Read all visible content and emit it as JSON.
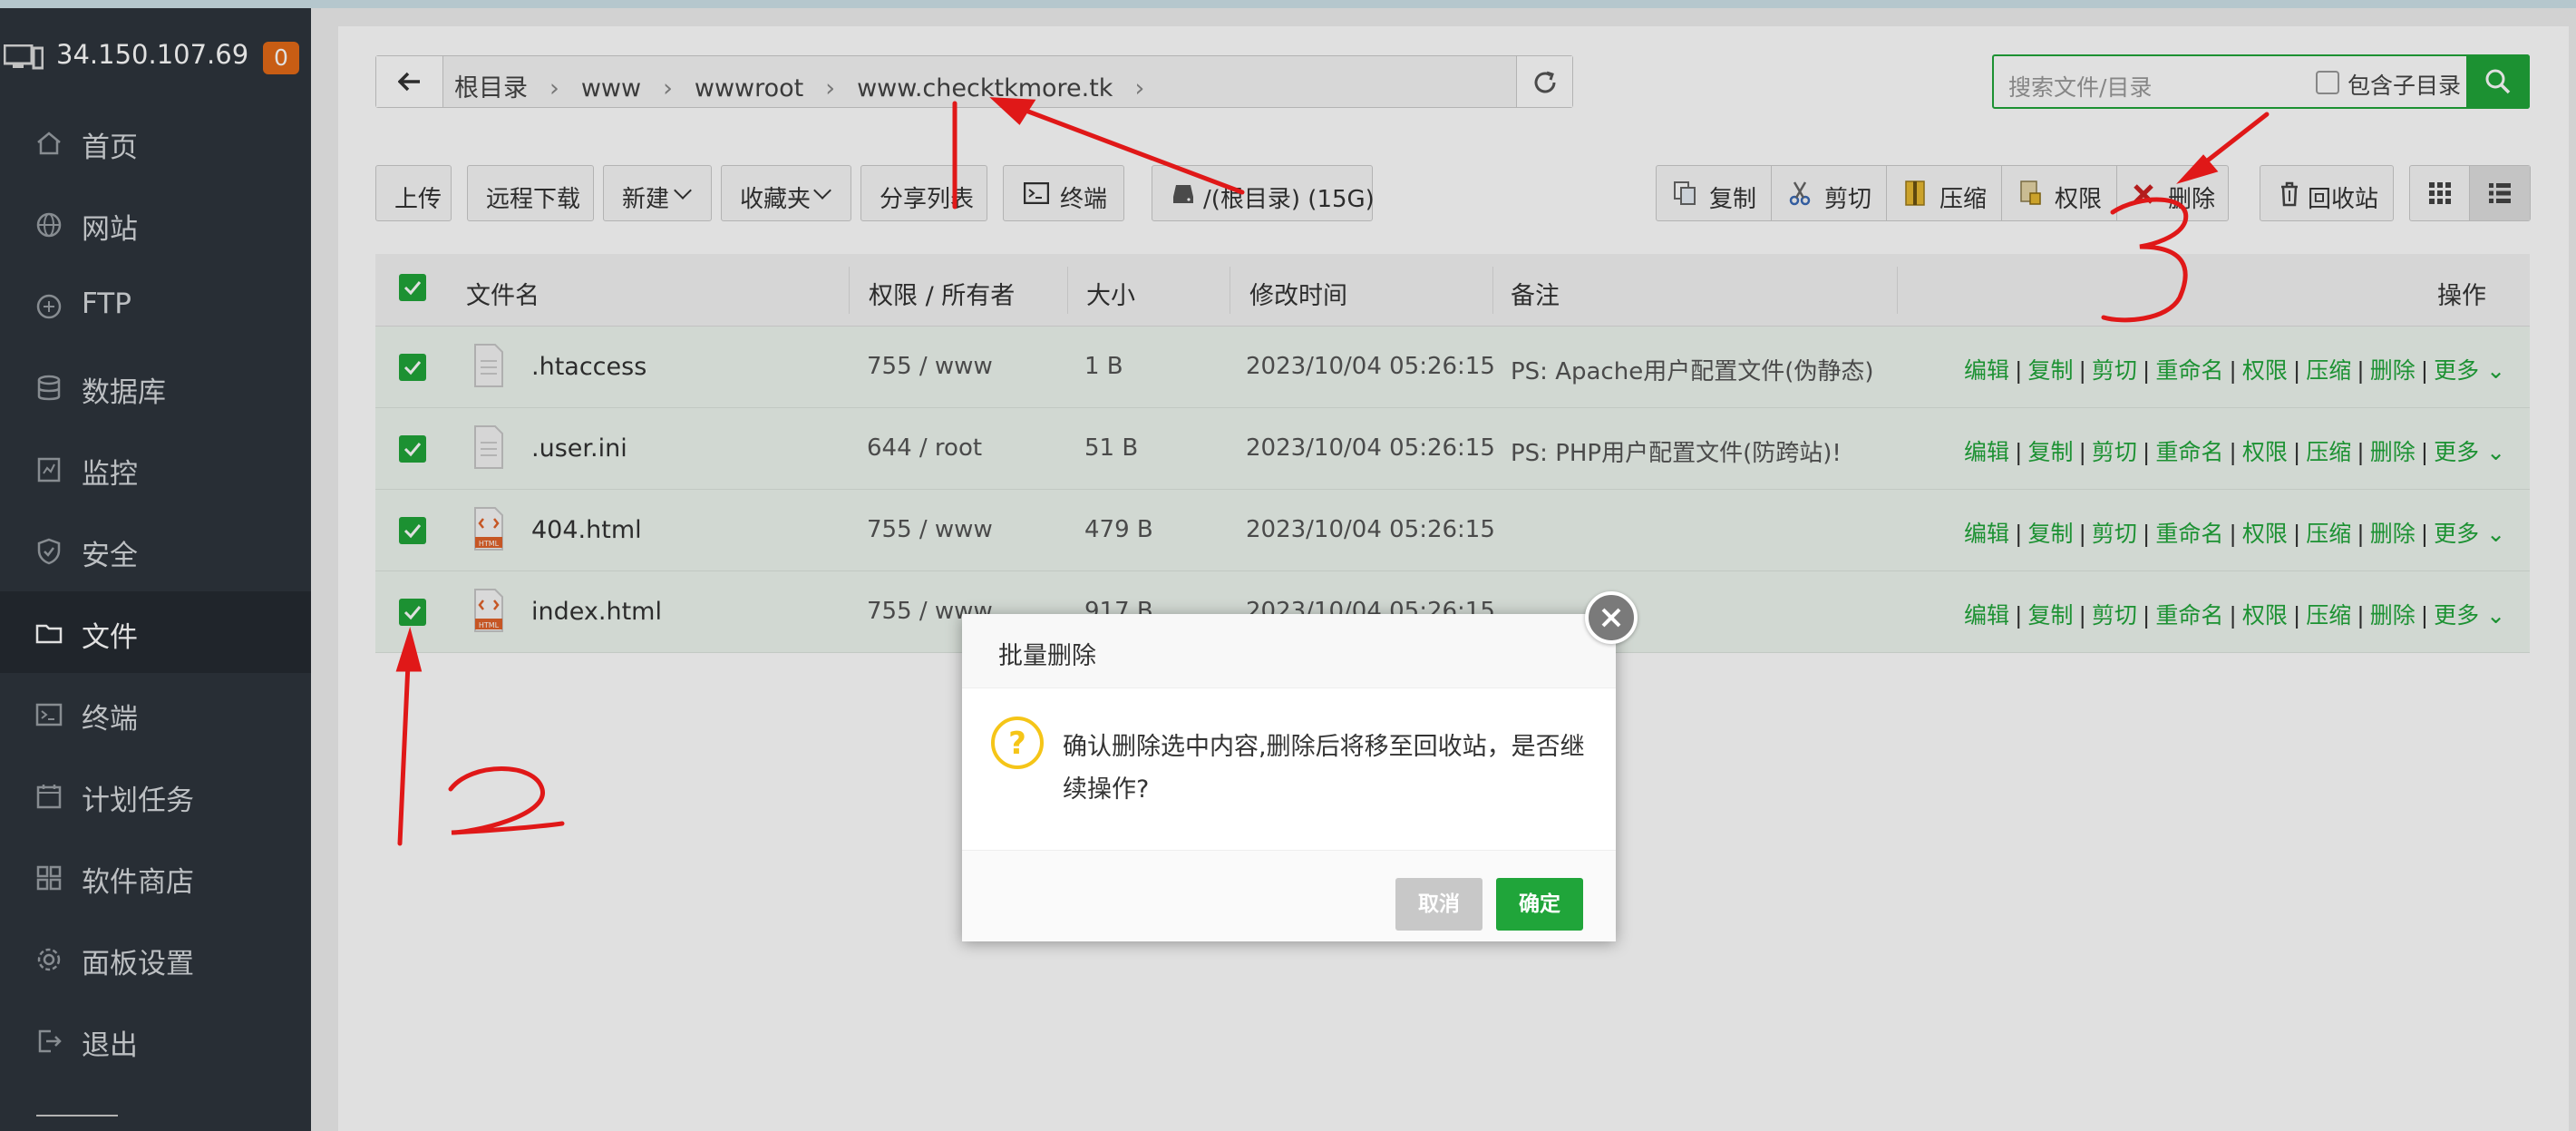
{
  "sidebar": {
    "ip": "34.150.107.69",
    "badge": "0",
    "items": [
      {
        "label": "首页",
        "icon": "home-icon"
      },
      {
        "label": "网站",
        "icon": "globe-icon"
      },
      {
        "label": "FTP",
        "icon": "ftp-icon"
      },
      {
        "label": "数据库",
        "icon": "database-icon"
      },
      {
        "label": "监控",
        "icon": "monitor-icon"
      },
      {
        "label": "安全",
        "icon": "shield-icon"
      },
      {
        "label": "文件",
        "icon": "folder-icon"
      },
      {
        "label": "终端",
        "icon": "terminal-icon"
      },
      {
        "label": "计划任务",
        "icon": "calendar-icon"
      },
      {
        "label": "软件商店",
        "icon": "apps-icon"
      },
      {
        "label": "面板设置",
        "icon": "gear-icon"
      },
      {
        "label": "退出",
        "icon": "logout-icon"
      }
    ],
    "active": "文件"
  },
  "breadcrumb": {
    "items": [
      "根目录",
      "www",
      "wwwroot",
      "www.checktkmore.tk"
    ]
  },
  "search": {
    "placeholder": "搜索文件/目录",
    "include_sub_label": "包含子目录"
  },
  "toolbar": {
    "upload": "上传",
    "remote_download": "远程下载",
    "new": "新建",
    "favorites": "收藏夹",
    "share_list": "分享列表",
    "terminal": "终端",
    "disk": "/(根目录) (15G)",
    "copy": "复制",
    "cut": "剪切",
    "compress": "压缩",
    "permission": "权限",
    "delete": "删除",
    "recycle": "回收站"
  },
  "table": {
    "headers": {
      "name": "文件名",
      "perm": "权限 / 所有者",
      "size": "大小",
      "mtime": "修改时间",
      "note": "备注",
      "ops": "操作"
    },
    "rows": [
      {
        "name": ".htaccess",
        "perm": "755 / www",
        "size": "1 B",
        "mtime": "2023/10/04 05:26:15",
        "note": "PS: Apache用户配置文件(伪静态)",
        "type": "text"
      },
      {
        "name": ".user.ini",
        "perm": "644 / root",
        "size": "51 B",
        "mtime": "2023/10/04 05:26:15",
        "note": "PS: PHP用户配置文件(防跨站)!",
        "type": "text"
      },
      {
        "name": "404.html",
        "perm": "755 / www",
        "size": "479 B",
        "mtime": "2023/10/04 05:26:15",
        "note": "",
        "type": "html"
      },
      {
        "name": "index.html",
        "perm": "755 / www",
        "size": "917 B",
        "mtime": "2023/10/04 05:26:15",
        "note": "",
        "type": "html"
      }
    ],
    "ops": [
      "编辑",
      "复制",
      "剪切",
      "重命名",
      "权限",
      "压缩",
      "删除",
      "更多"
    ]
  },
  "dialog": {
    "title": "批量删除",
    "message": "确认删除选中内容,删除后将移至回收站，是否继续操作?",
    "cancel": "取消",
    "ok": "确定"
  },
  "annotations": {
    "color": "#e01818",
    "labels": [
      "1",
      "2",
      "3"
    ]
  }
}
